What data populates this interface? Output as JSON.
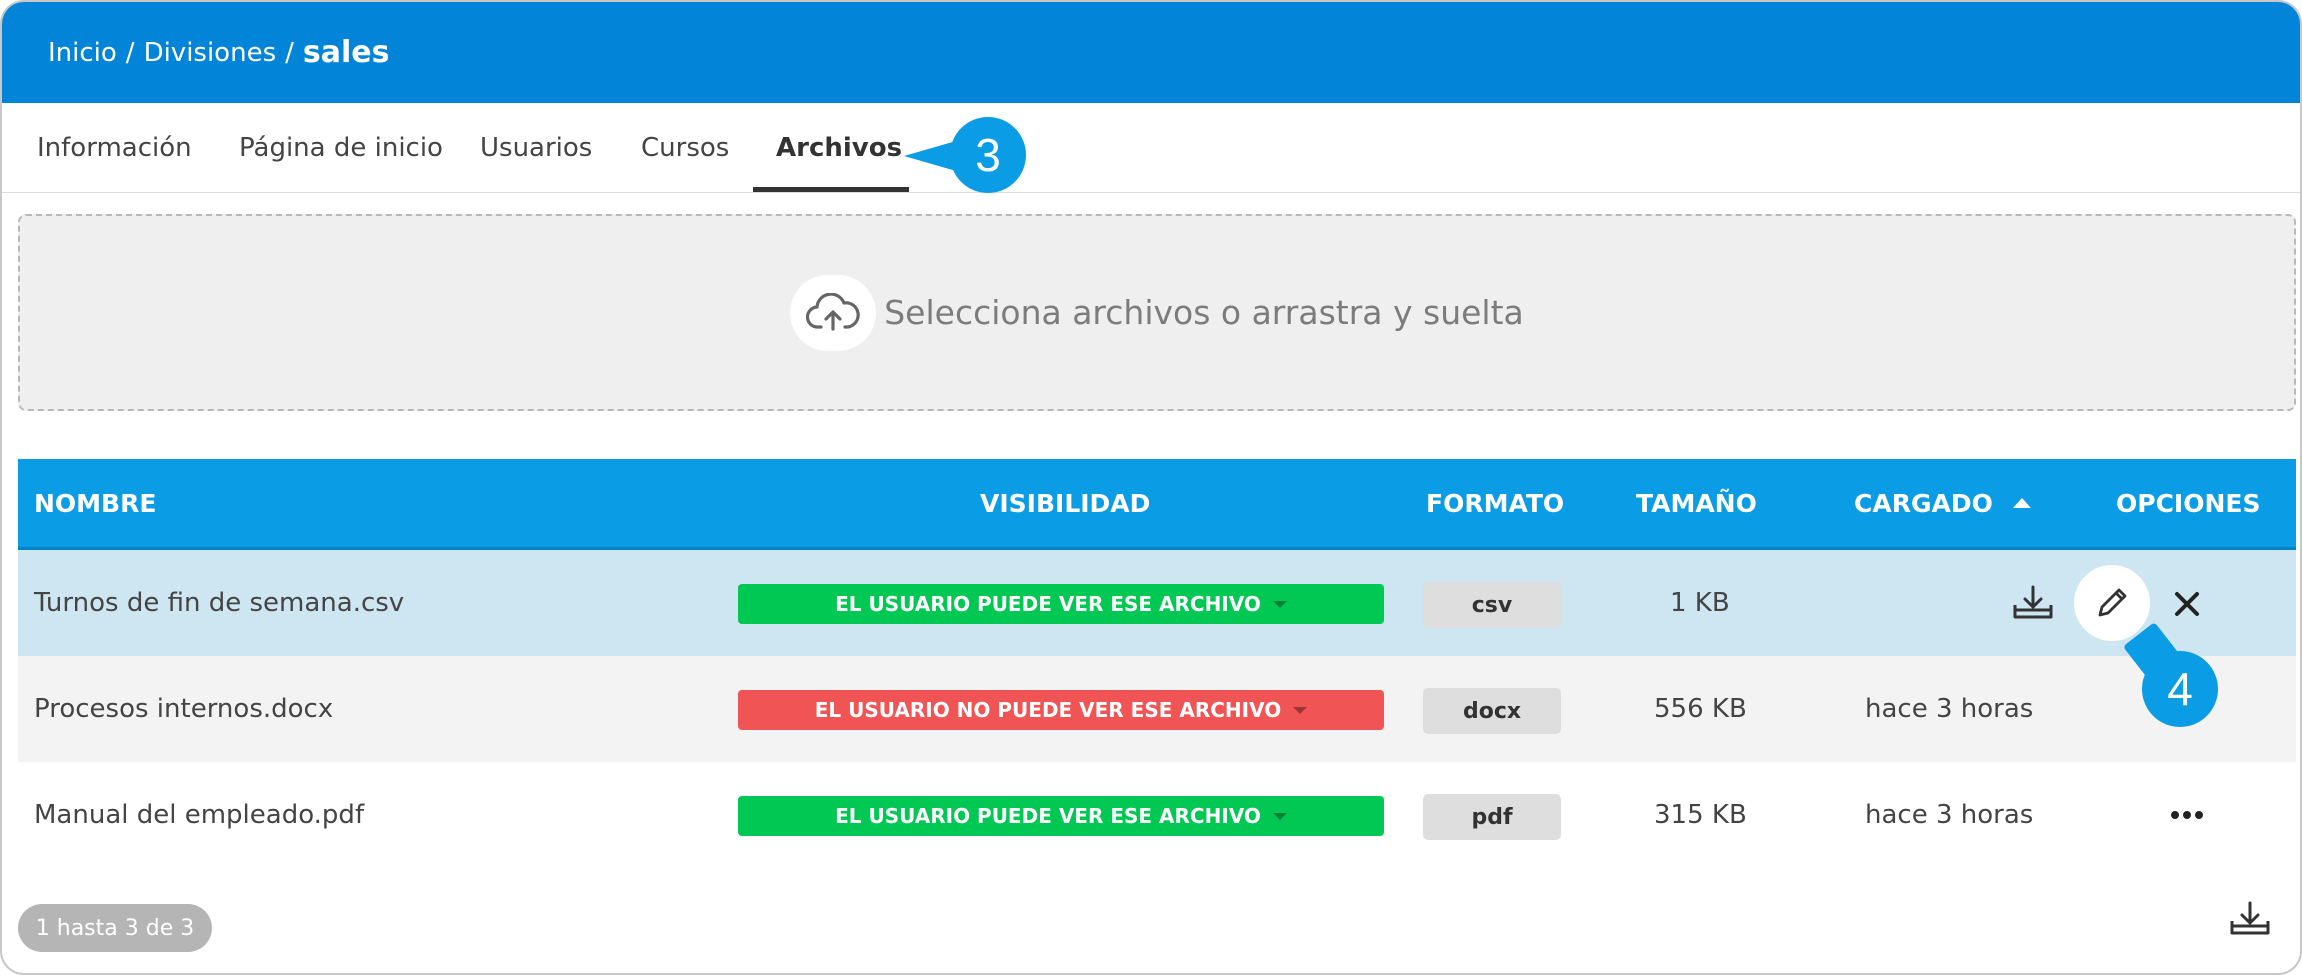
{
  "breadcrumb": {
    "items": [
      "Inicio",
      "Divisiones"
    ],
    "separator": "/",
    "current": "sales"
  },
  "tabs": [
    {
      "label": "Información"
    },
    {
      "label": "Página de inicio"
    },
    {
      "label": "Usuarios"
    },
    {
      "label": "Cursos"
    },
    {
      "label": "Archivos",
      "active": true
    }
  ],
  "callouts": {
    "tabs": "3",
    "edit": "4"
  },
  "dropzone": {
    "text": "Selecciona archivos o arrastra y suelta",
    "icon": "cloud-upload-icon"
  },
  "table": {
    "columns": {
      "name": "NOMBRE",
      "visibility": "VISIBILIDAD",
      "format": "FORMATO",
      "size": "TAMAÑO",
      "uploaded": "CARGADO",
      "options": "OPCIONES"
    },
    "sort": {
      "column": "CARGADO",
      "direction": "asc"
    },
    "rows": [
      {
        "name": "Turnos de fin de semana.csv",
        "visibility": "EL USUARIO PUEDE VER ESE ARCHIVO",
        "visible": true,
        "format": "csv",
        "size": "1 KB",
        "uploaded": ""
      },
      {
        "name": "Procesos internos.docx",
        "visibility": "EL USUARIO NO PUEDE VER ESE ARCHIVO",
        "visible": false,
        "format": "docx",
        "size": "556 KB",
        "uploaded": "hace 3 horas"
      },
      {
        "name": "Manual del empleado.pdf",
        "visibility": "EL USUARIO PUEDE VER ESE ARCHIVO",
        "visible": true,
        "format": "pdf",
        "size": "315 KB",
        "uploaded": "hace 3 horas"
      }
    ]
  },
  "pager": {
    "text": "1 hasta 3 de 3"
  },
  "colors": {
    "header": "#0284d8",
    "table_header": "#0a9ce4",
    "visible_badge": "#00c853",
    "hidden_badge": "#f05454",
    "selected_row": "#cde6f2",
    "callout": "#0a9ce4"
  }
}
